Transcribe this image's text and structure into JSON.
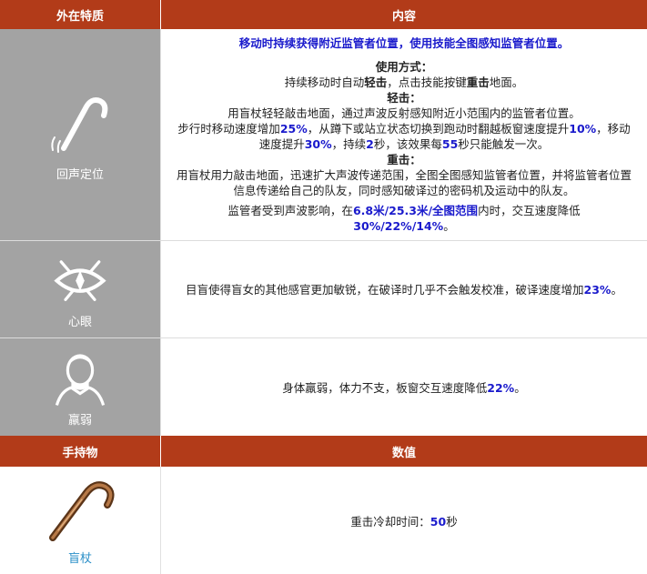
{
  "header1": {
    "col1": "外在特质",
    "col2": "内容"
  },
  "traits": [
    {
      "name": "回声定位",
      "icon": "cane-hook-icon",
      "intro": "移动时持续获得附近监管者位置，使用技能全图感知监管者位置。",
      "usage_title": "使用方式：",
      "usage_pre": "持续移动时自动",
      "usage_bold1": "轻击",
      "usage_mid": "，点击技能按键",
      "usage_bold2": "重击",
      "usage_post": "地面。",
      "light_title": "轻击：",
      "light_line1": "用盲杖轻轻敲击地面，通过声波反射感知附近小范围内的监管者位置。",
      "light_p1": "步行时移动速度增加",
      "light_n1": "25%",
      "light_p2": "，从蹲下或站立状态切换到跑动时翻越板窗速度提升",
      "light_n2": "10%",
      "light_p3": "，移动速度提升",
      "light_n3": "30%",
      "light_p4": "，持续",
      "light_n4": "2",
      "light_p5": "秒，该效果每",
      "light_n5": "55",
      "light_p6": "秒只能触发一次。",
      "heavy_title": "重击：",
      "heavy_line": "用盲杖用力敲击地面，迅速扩大声波传递范围，全图全图感知监管者位置，并将监管者位置信息传递给自己的队友，同时感知破译过的密码机及运动中的队友。",
      "hunter_pre": "监管者受到声波影响，在",
      "hunter_range": "6.8米/25.3米/全图范围",
      "hunter_mid": "内时，交互速度降低",
      "hunter_values": "30%/22%/14%",
      "hunter_post": "。"
    },
    {
      "name": "心眼",
      "icon": "mind-eye-icon",
      "text_pre": "目盲使得盲女的其他感官更加敏锐，在破译时几乎不会触发校准，破译速度增加",
      "text_num": "23%",
      "text_post": "。"
    },
    {
      "name": "羸弱",
      "icon": "frail-figure-icon",
      "text_pre": "身体羸弱，体力不支，板窗交互速度降低",
      "text_num": "22%",
      "text_post": "。"
    }
  ],
  "header2": {
    "col1": "手持物",
    "col2": "数值"
  },
  "item": {
    "name": "盲杖",
    "icon": "walking-cane-icon",
    "text_pre": "重击冷却时间：",
    "text_num": "50",
    "text_post": "秒"
  },
  "colors": {
    "header_bg": "#b23b19",
    "trait_bg": "#a3a3a3",
    "highlight_blue": "#1a1acc",
    "item_name_blue": "#2a8fc8"
  }
}
